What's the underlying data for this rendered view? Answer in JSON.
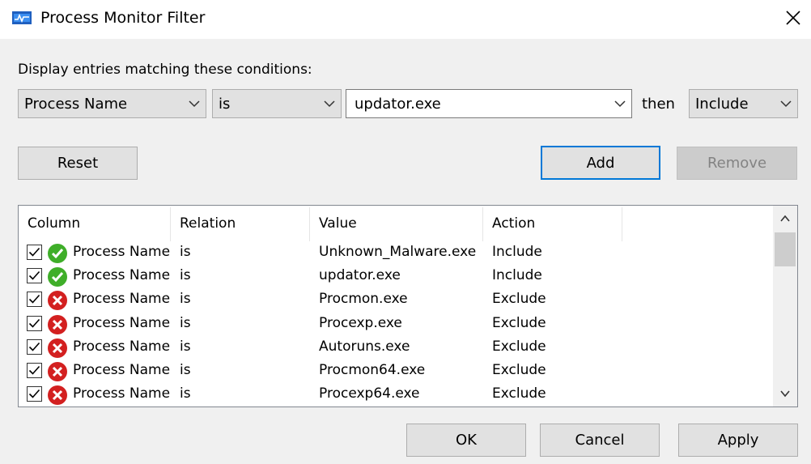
{
  "window": {
    "title": "Process Monitor Filter"
  },
  "filter": {
    "prompt": "Display entries matching these conditions:",
    "column_value": "Process Name",
    "relation_value": "is",
    "value_text": "updator.exe",
    "then_label": "then",
    "action_value": "Include"
  },
  "buttons": {
    "reset": "Reset",
    "add": "Add",
    "remove": "Remove",
    "ok": "OK",
    "cancel": "Cancel",
    "apply": "Apply"
  },
  "list": {
    "headers": {
      "column": "Column",
      "relation": "Relation",
      "value": "Value",
      "action": "Action"
    },
    "rows": [
      {
        "checked": true,
        "status": "include",
        "column": "Process Name",
        "relation": "is",
        "value": "Unknown_Malware.exe",
        "action": "Include"
      },
      {
        "checked": true,
        "status": "include",
        "column": "Process Name",
        "relation": "is",
        "value": "updator.exe",
        "action": "Include"
      },
      {
        "checked": true,
        "status": "exclude",
        "column": "Process Name",
        "relation": "is",
        "value": "Procmon.exe",
        "action": "Exclude"
      },
      {
        "checked": true,
        "status": "exclude",
        "column": "Process Name",
        "relation": "is",
        "value": "Procexp.exe",
        "action": "Exclude"
      },
      {
        "checked": true,
        "status": "exclude",
        "column": "Process Name",
        "relation": "is",
        "value": "Autoruns.exe",
        "action": "Exclude"
      },
      {
        "checked": true,
        "status": "exclude",
        "column": "Process Name",
        "relation": "is",
        "value": "Procmon64.exe",
        "action": "Exclude"
      },
      {
        "checked": true,
        "status": "exclude",
        "column": "Process Name",
        "relation": "is",
        "value": "Procexp64.exe",
        "action": "Exclude"
      }
    ]
  },
  "colors": {
    "accent": "#0078d7",
    "include_green": "#3fae29",
    "exclude_red": "#d32020"
  }
}
